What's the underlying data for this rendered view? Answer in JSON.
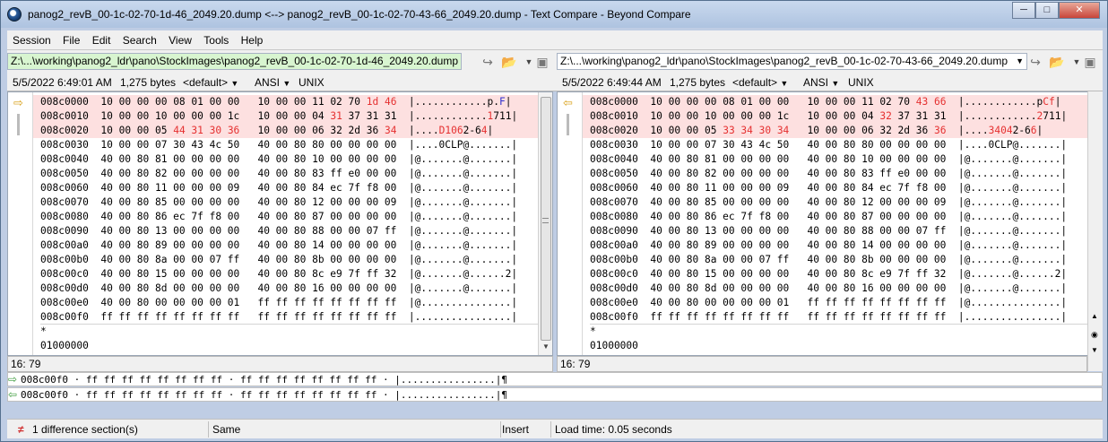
{
  "window": {
    "title": "panog2_revB_00-1c-02-70-1d-46_2049.20.dump <--> panog2_revB_00-1c-02-70-43-66_2049.20.dump - Text Compare - Beyond Compare",
    "minimize": "─",
    "maximize": "□",
    "close": "✕"
  },
  "menu": [
    "Session",
    "File",
    "Edit",
    "Search",
    "View",
    "Tools",
    "Help"
  ],
  "left": {
    "path": "Z:\\...\\working\\panog2_ldr\\pano\\StockImages\\panog2_revB_00-1c-02-70-1d-46_2049.20.dump",
    "timestamp": "5/5/2022 6:49:01 AM",
    "size": "1,275 bytes",
    "format": "<default>",
    "encoding": "ANSI",
    "lineend": "UNIX",
    "position": "16: 79"
  },
  "right": {
    "path": "Z:\\...\\working\\panog2_ldr\\pano\\StockImages\\panog2_revB_00-1c-02-70-43-66_2049.20.dump",
    "timestamp": "5/5/2022 6:49:44 AM",
    "size": "1,275 bytes",
    "format": "<default>",
    "encoding": "ANSI",
    "lineend": "UNIX",
    "position": "16: 79"
  },
  "dump_rows_common": [
    {
      "addr": "008c0030",
      "hex": "10 00 00 07 30 43 4c 50   40 00 80 80 00 00 00 00",
      "asc": "....0CLP@......."
    },
    {
      "addr": "008c0040",
      "hex": "40 00 80 81 00 00 00 00   40 00 80 10 00 00 00 00",
      "asc": "@.......@......."
    },
    {
      "addr": "008c0050",
      "hex": "40 00 80 82 00 00 00 00   40 00 80 83 ff e0 00 00",
      "asc": "@.......@......."
    },
    {
      "addr": "008c0060",
      "hex": "40 00 80 11 00 00 00 09   40 00 80 84 ec 7f f8 00",
      "asc": "@.......@......."
    },
    {
      "addr": "008c0070",
      "hex": "40 00 80 85 00 00 00 00   40 00 80 12 00 00 00 09",
      "asc": "@.......@......."
    },
    {
      "addr": "008c0080",
      "hex": "40 00 80 86 ec 7f f8 00   40 00 80 87 00 00 00 00",
      "asc": "@.......@......."
    },
    {
      "addr": "008c0090",
      "hex": "40 00 80 13 00 00 00 00   40 00 80 88 00 00 07 ff",
      "asc": "@.......@......."
    },
    {
      "addr": "008c00a0",
      "hex": "40 00 80 89 00 00 00 00   40 00 80 14 00 00 00 00",
      "asc": "@.......@......."
    },
    {
      "addr": "008c00b0",
      "hex": "40 00 80 8a 00 00 07 ff   40 00 80 8b 00 00 00 00",
      "asc": "@.......@......."
    },
    {
      "addr": "008c00c0",
      "hex": "40 00 80 15 00 00 00 00   40 00 80 8c e9 7f ff 32",
      "asc": "@.......@......2"
    },
    {
      "addr": "008c00d0",
      "hex": "40 00 80 8d 00 00 00 00   40 00 80 16 00 00 00 00",
      "asc": "@.......@......."
    },
    {
      "addr": "008c00e0",
      "hex": "40 00 80 00 00 00 00 01   ff ff ff ff ff ff ff ff",
      "asc": "@..............."
    },
    {
      "addr": "008c00f0",
      "hex": "ff ff ff ff ff ff ff ff   ff ff ff ff ff ff ff ff",
      "asc": "................"
    }
  ],
  "left_diff_rows": [
    {
      "addr": "008c0000",
      "hex_a": "10 00 00 00 08 01 00 00   10 00 00 11 02 70 ",
      "hex_r": "1d 46",
      "asc_a": "............p.",
      "asc_b": "F"
    },
    {
      "addr": "008c0010",
      "hex_a": "10 00 00 10 00 00 00 1c   10 00 00 04 ",
      "hex_r": "31",
      "hex_c": " 37 31 31",
      "asc_a": "............",
      "asc_r": "1",
      "asc_c": "711"
    },
    {
      "addr": "008c0020",
      "hex_a": "10 00 00 05 ",
      "hex_r": "44 31 30 36",
      "hex_c": "   10 00 00 06 32 2d 36 ",
      "hex_r2": "34",
      "asc_a": "....",
      "asc_r": "D106",
      "asc_c": "2-6",
      "asc_r2": "4"
    }
  ],
  "right_diff_rows": [
    {
      "addr": "008c0000",
      "hex_a": "10 00 00 00 08 01 00 00   10 00 00 11 02 70 ",
      "hex_r": "43 66",
      "asc_a": "............p",
      "asc_b": "Cf"
    },
    {
      "addr": "008c0010",
      "hex_a": "10 00 00 10 00 00 00 1c   10 00 00 04 ",
      "hex_r": "32",
      "hex_c": " 37 31 31",
      "asc_a": "............",
      "asc_r": "2",
      "asc_c": "711"
    },
    {
      "addr": "008c0020",
      "hex_a": "10 00 00 05 ",
      "hex_r": "33 34 30 34",
      "hex_c": "   10 00 00 06 32 2d 36 ",
      "hex_r2": "36",
      "asc_a": "....",
      "asc_r": "3404",
      "asc_c": "2-6",
      "asc_r2": "6"
    }
  ],
  "tail": {
    "star": "*",
    "end": "01000000"
  },
  "compare_lines": {
    "line1": "008c00f0 · ff ff ff ff ff ff ff ff · ff ff ff ff ff ff ff ff · |................|¶",
    "line2": "008c00f0 · ff ff ff ff ff ff ff ff · ff ff ff ff ff ff ff ff · |................|¶"
  },
  "status": {
    "differences": "1 difference section(s)",
    "same": "Same",
    "mode": "Insert",
    "load": "Load time: 0.05 seconds"
  },
  "colors": {
    "diff_bg": "#fde0e0",
    "diff_text": "#e53030",
    "accent": "#3a9a3a"
  }
}
